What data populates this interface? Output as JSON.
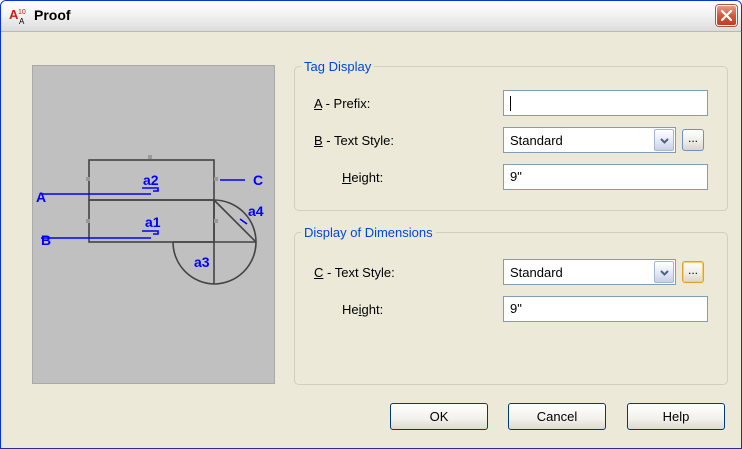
{
  "window": {
    "title": "Proof"
  },
  "preview": {
    "labels": {
      "a": "A",
      "b": "B",
      "c": "C"
    },
    "tags": {
      "a1": "a1",
      "a2": "a2",
      "a3": "a3",
      "a4": "a4"
    }
  },
  "tag_display": {
    "legend": "Tag Display",
    "prefix": {
      "mnemonic": "A",
      "label_rest": " - Prefix:",
      "value": ""
    },
    "text_style": {
      "mnemonic": "B",
      "label_rest": " - Text Style:",
      "value": "Standard",
      "browse_label": "..."
    },
    "height": {
      "label_pre": "",
      "mnemonic": "H",
      "label_rest": "eight:",
      "value": "9\""
    }
  },
  "display_of_dimensions": {
    "legend": "Display of Dimensions",
    "text_style": {
      "mnemonic": "C",
      "label_rest": " - Text Style:",
      "value": "Standard",
      "browse_label": "..."
    },
    "height": {
      "label_pre": "He",
      "mnemonic": "i",
      "label_rest": "ght:",
      "value": "9\""
    }
  },
  "buttons": {
    "ok": "OK",
    "cancel": "Cancel",
    "help": "Help"
  },
  "colors": {
    "accent_blue": "#0000ff",
    "legend_blue": "#0046d5",
    "close_red": "#d9573f"
  }
}
